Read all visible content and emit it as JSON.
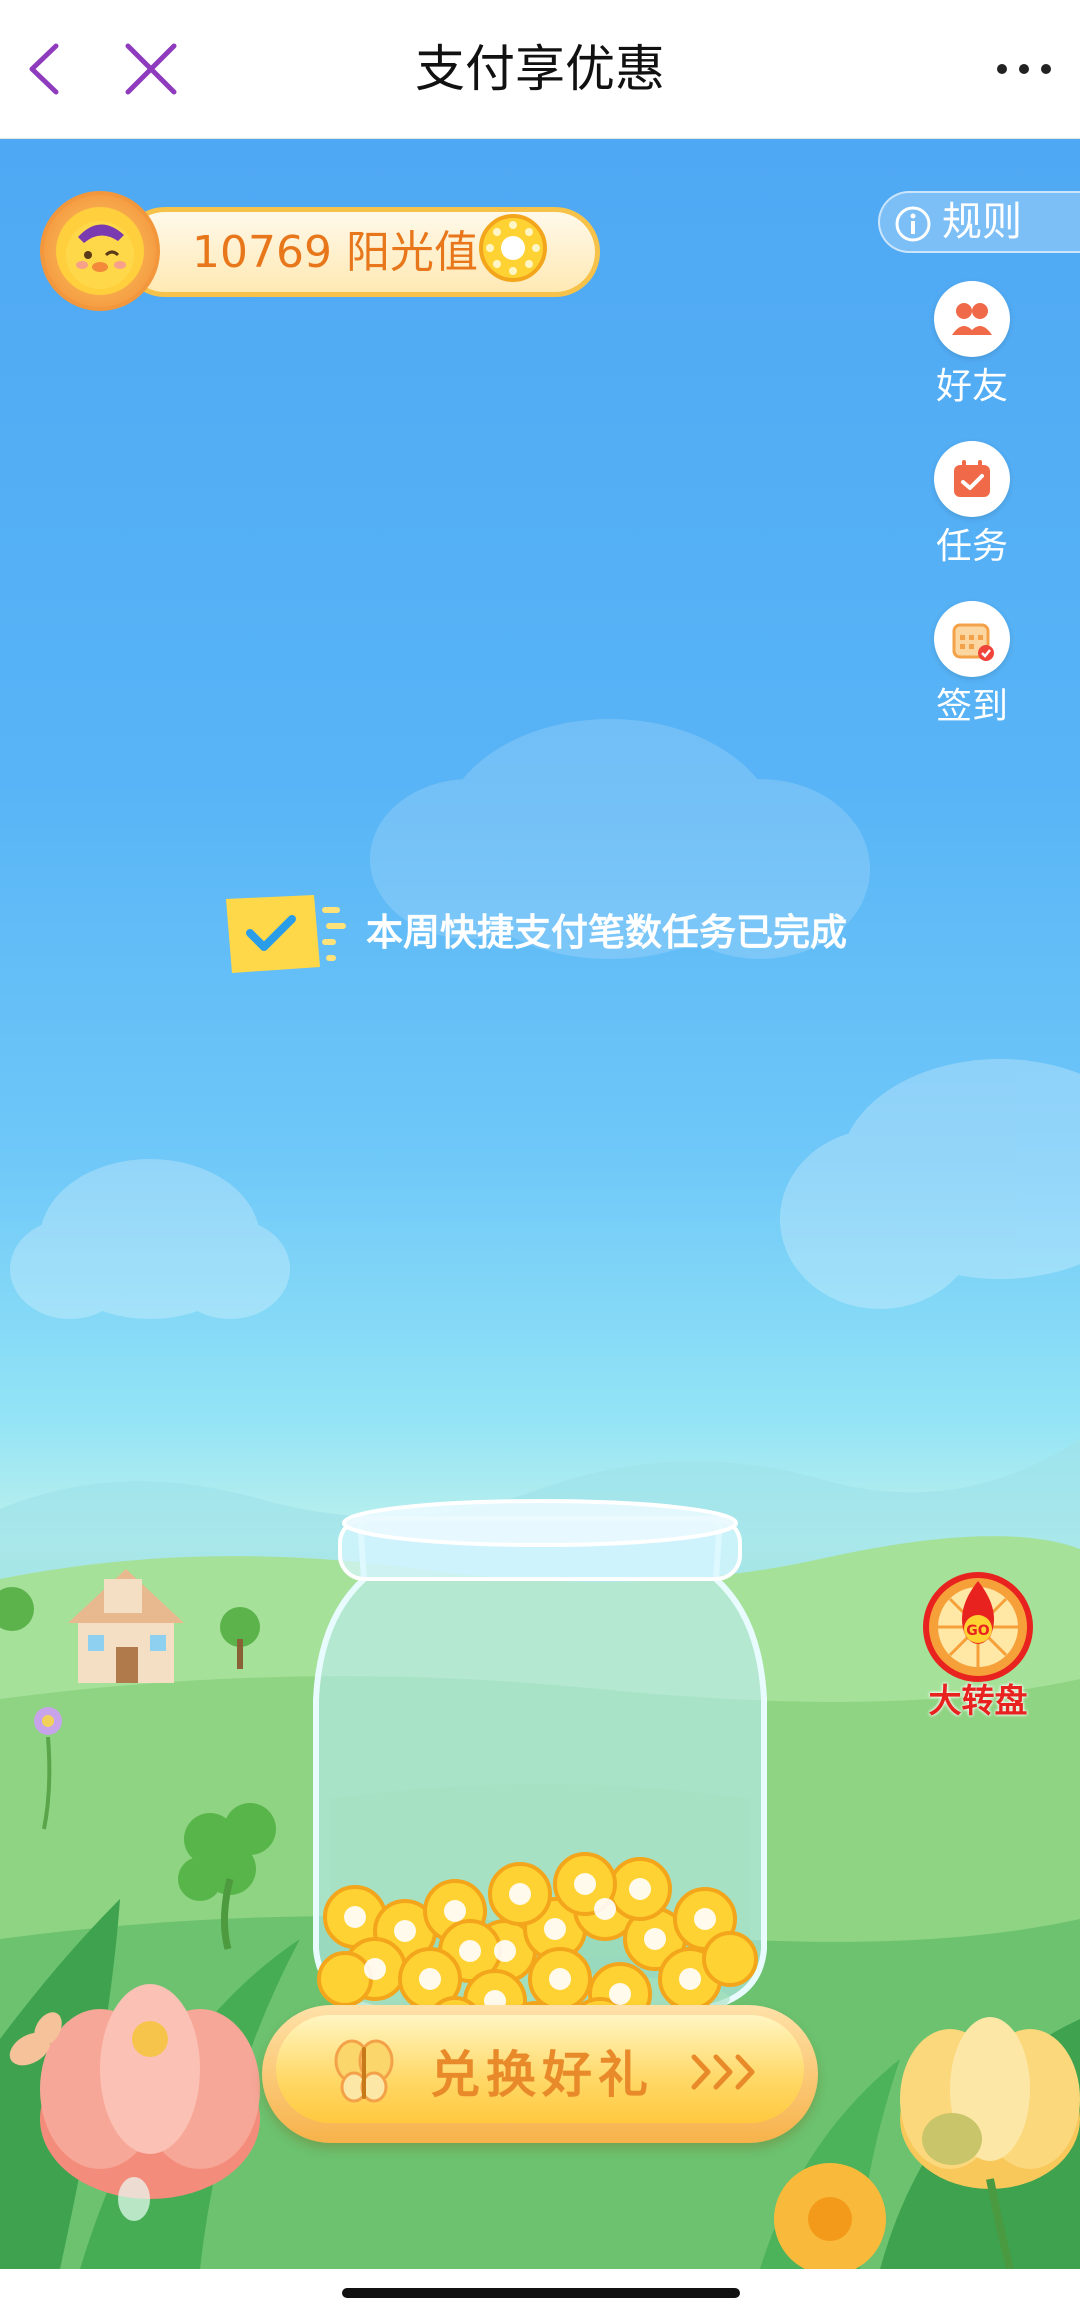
{
  "header": {
    "title": "支付享优惠"
  },
  "balance": {
    "amount": "10769",
    "unit": "阳光值",
    "text": "10769 阳光值"
  },
  "rules": {
    "label": "规则"
  },
  "side_buttons": [
    {
      "label": "好友",
      "icon": "friends-icon"
    },
    {
      "label": "任务",
      "icon": "task-calendar-icon"
    },
    {
      "label": "签到",
      "icon": "checkin-calendar-icon"
    }
  ],
  "notice": {
    "text": "本周快捷支付笔数任务已完成"
  },
  "wheel": {
    "label": "大转盘"
  },
  "redeem": {
    "label": "兑换好礼",
    "arrows": "›››"
  },
  "colors": {
    "sky": "#4fa8f3",
    "grass": "#4cb35a",
    "accent_orange": "#e8761a",
    "coin_gold": "#ffd233",
    "nav_icon_purple": "#8e3bbd",
    "wheel_red": "#e8231f"
  }
}
